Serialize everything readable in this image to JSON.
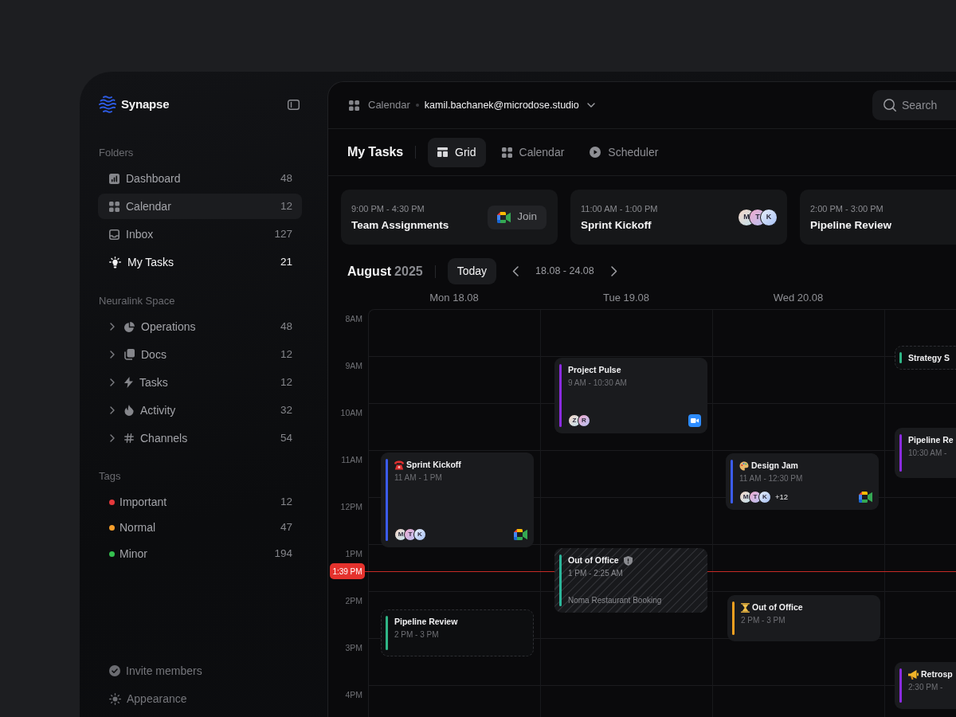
{
  "sidebar": {
    "brand": "Synapse",
    "folders": {
      "title": "Folders",
      "items": [
        {
          "label": "Dashboard",
          "count": "48",
          "selected": false,
          "current": false
        },
        {
          "label": "Calendar",
          "count": "12",
          "selected": true,
          "current": false
        },
        {
          "label": "Inbox",
          "count": "127",
          "selected": false,
          "current": false
        },
        {
          "label": "My Tasks",
          "count": "21",
          "selected": false,
          "current": true
        }
      ]
    },
    "space": {
      "title": "Neuralink Space",
      "items": [
        {
          "label": "Operations",
          "count": "48",
          "expanded": false
        },
        {
          "label": "Docs",
          "count": "12",
          "expanded": false
        },
        {
          "label": "Tasks",
          "count": "12",
          "expanded": false
        },
        {
          "label": "Activity",
          "count": "32",
          "expanded": false
        },
        {
          "label": "Channels",
          "count": "54",
          "expanded": false
        }
      ]
    },
    "tags": {
      "title": "Tags",
      "items": [
        {
          "label": "Important",
          "count": "12",
          "color": "#e5383b"
        },
        {
          "label": "Normal",
          "count": "47",
          "color": "#f59e2b"
        },
        {
          "label": "Minor",
          "count": "194",
          "color": "#35c04f"
        }
      ]
    },
    "footer": [
      {
        "label": "Invite members"
      },
      {
        "label": "Appearance"
      }
    ]
  },
  "topbar": {
    "breadcrumb": "Calendar",
    "account": "kamil.bachanek@microdose.studio",
    "search": {
      "placeholder": "Search"
    }
  },
  "view": {
    "title": "My Tasks",
    "tabs": [
      {
        "label": "Grid",
        "selected": true
      },
      {
        "label": "Calendar",
        "selected": false
      },
      {
        "label": "Scheduler",
        "selected": false
      }
    ]
  },
  "upcoming": [
    {
      "kind": "join",
      "time": "9:00 PM - 4:30 PM",
      "title": "Team Assignments",
      "action": "Join"
    },
    {
      "kind": "attendees",
      "time": "11:00 AM - 1:00 PM",
      "title": "Sprint Kickoff",
      "attendees": [
        "M",
        "T",
        "K"
      ]
    },
    {
      "kind": "plain",
      "time": "2:00 PM - 3:00 PM",
      "title": "Pipeline Review"
    }
  ],
  "calendar": {
    "month": "August",
    "year": "2025",
    "today": "Today",
    "range": "18.08 - 24.08",
    "now": "1:39 PM",
    "hours": [
      "8AM",
      "9AM",
      "10AM",
      "11AM",
      "12PM",
      "1PM",
      "2PM",
      "3PM",
      "4PM"
    ],
    "days": [
      {
        "label": "Mon 18.08",
        "events": [
          {
            "title": "Sprint Kickoff",
            "time": "11 AM - 1 PM",
            "color": "#3b5cf0",
            "attendees": [
              "M",
              "T",
              "K"
            ],
            "tentative": false,
            "private": false
          },
          {
            "title": "Pipeline Review",
            "time": "2 PM - 3 PM",
            "color": "#2fb586",
            "tentative": true,
            "private": false
          }
        ]
      },
      {
        "label": "Tue 19.08",
        "events": [
          {
            "title": "Project Pulse",
            "time": "9 AM - 10:30 AM",
            "color": "#8b2be0",
            "attendees": [
              "Z",
              "R"
            ],
            "tentative": false,
            "private": false
          },
          {
            "title": "Out of Office",
            "time": "1 PM - 2:25 AM",
            "note": "Noma Restaurant Booking",
            "color": "#2bb59a",
            "tentative": false,
            "private": true
          }
        ]
      },
      {
        "label": "Wed 20.08",
        "events": [
          {
            "title": "Design Jam",
            "time": "11 AM - 12:30 PM",
            "color": "#3b5cf0",
            "attendees": [
              "M",
              "T",
              "K"
            ],
            "extra": "+12",
            "tentative": false,
            "private": false
          },
          {
            "title": "Out of Office",
            "time": "2 PM - 3 PM",
            "color": "#f5a020",
            "tentative": false,
            "private": false
          }
        ]
      },
      {
        "events": [
          {
            "title": "Strategy S",
            "color": "#2fb586",
            "tentative": true,
            "private": false
          },
          {
            "title": "Pipeline Re",
            "time": "10:30 AM -",
            "color": "#8b2be0",
            "tentative": false,
            "private": false
          },
          {
            "title": "Retrosp",
            "time": "2:30 PM -",
            "color": "#8b2be0",
            "tentative": false,
            "private": false
          }
        ]
      }
    ]
  }
}
